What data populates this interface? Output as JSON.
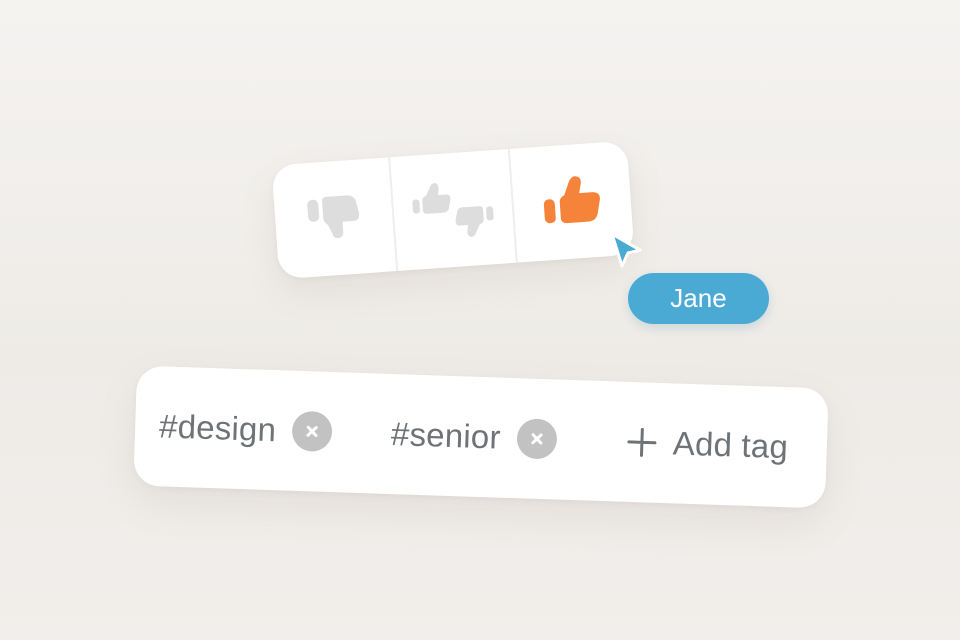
{
  "rating": {
    "options": [
      {
        "name": "thumbs-down",
        "icon": "thumbs-down-icon",
        "color": "#dddddd",
        "selected": false
      },
      {
        "name": "mixed",
        "icon": "thumbs-mixed-icon",
        "color": "#dddddd",
        "selected": false
      },
      {
        "name": "thumbs-up",
        "icon": "thumbs-up-icon",
        "color": "#f5843a",
        "selected": true
      }
    ]
  },
  "cursor": {
    "icon": "pointer-cursor-icon",
    "color": "#4aaad4",
    "user_name": "Jane"
  },
  "tags": {
    "items": [
      {
        "label": "#design",
        "remove_icon": "close-icon"
      },
      {
        "label": "#senior",
        "remove_icon": "close-icon"
      }
    ],
    "add_label": "Add tag",
    "add_icon": "plus-icon"
  },
  "colors": {
    "accent": "#f5843a",
    "cursor": "#4aaad4",
    "tag_text": "#6e7378",
    "remove_badge": "#c2c2c2"
  }
}
